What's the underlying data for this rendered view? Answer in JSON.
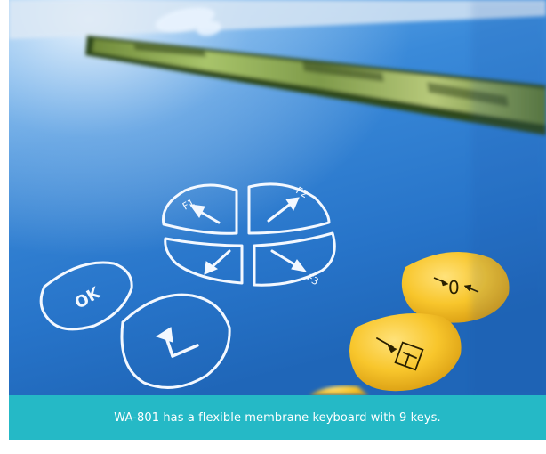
{
  "caption": {
    "text": "WA-801 has a flexible membrane keyboard with 9 keys."
  },
  "keys": {
    "ok_label": "OK",
    "zero_label": "→0←"
  },
  "colors": {
    "panel_blue": "#2a78cf",
    "caption_teal": "#25b9c6",
    "key_yellow": "#f6c22a"
  },
  "icons": {
    "f1": "arrow-up-left-f1-icon",
    "f2": "arrow-up-right-f2-icon",
    "down_left": "arrow-down-left-icon",
    "f3": "arrow-down-right-f3-icon",
    "enter": "enter-return-icon",
    "tare": "tare-icon"
  }
}
